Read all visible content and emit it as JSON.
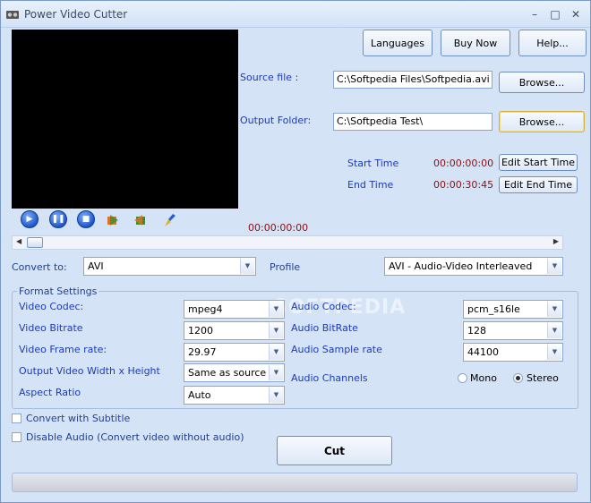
{
  "window": {
    "title": "Power Video Cutter",
    "controls": {
      "minimize": "–",
      "maximize": "□",
      "close": "✕"
    }
  },
  "top_buttons": {
    "languages": "Languages",
    "buy_now": "Buy Now",
    "help": "Help..."
  },
  "files": {
    "source_label": "Source file :",
    "source_value": "C:\\Softpedia Files\\Softpedia.avi",
    "source_browse": "Browse...",
    "output_label": "Output Folder:",
    "output_value": "C:\\Softpedia Test\\",
    "output_browse": "Browse..."
  },
  "times": {
    "start_label": "Start Time",
    "start_value": "00:00:00:00",
    "edit_start": "Edit Start Time",
    "end_label": "End Time",
    "end_value": "00:00:30:45",
    "edit_end": "Edit End Time",
    "current_position": "00:00:00:00"
  },
  "playback": {
    "icons": [
      "play-icon",
      "pause-icon",
      "stop-icon",
      "set-start-icon",
      "set-end-icon",
      "clean-icon"
    ]
  },
  "convert": {
    "convert_to_label": "Convert to:",
    "convert_to_value": "AVI",
    "profile_label": "Profile",
    "profile_value": "AVI - Audio-Video Interleaved"
  },
  "format": {
    "legend": "Format Settings",
    "video_codec_label": "Video Codec:",
    "video_codec_value": "mpeg4",
    "video_bitrate_label": "Video Bitrate",
    "video_bitrate_value": "1200",
    "frame_rate_label": "Video Frame rate:",
    "frame_rate_value": "29.97",
    "size_label": "Output Video Width x Height",
    "size_value": "Same as source",
    "aspect_label": "Aspect Ratio",
    "aspect_value": "Auto",
    "audio_codec_label": "Audio Codec:",
    "audio_codec_value": "pcm_s16le",
    "audio_bitrate_label": "Audio BitRate",
    "audio_bitrate_value": "128",
    "sample_rate_label": "Audio Sample rate",
    "sample_rate_value": "44100",
    "channels_label": "Audio Channels",
    "mono_label": "Mono",
    "stereo_label": "Stereo",
    "selected_channel": "Stereo"
  },
  "options": {
    "subtitle_label": "Convert with Subtitle",
    "disable_audio_label": "Disable Audio (Convert video without audio)"
  },
  "actions": {
    "cut": "Cut"
  },
  "watermark": "SOFTPEDIA",
  "colors": {
    "window_bg": "#d5e3f7",
    "label_blue": "#1c3bb8",
    "time_red": "#8b1010",
    "video_bg": "#000000"
  }
}
